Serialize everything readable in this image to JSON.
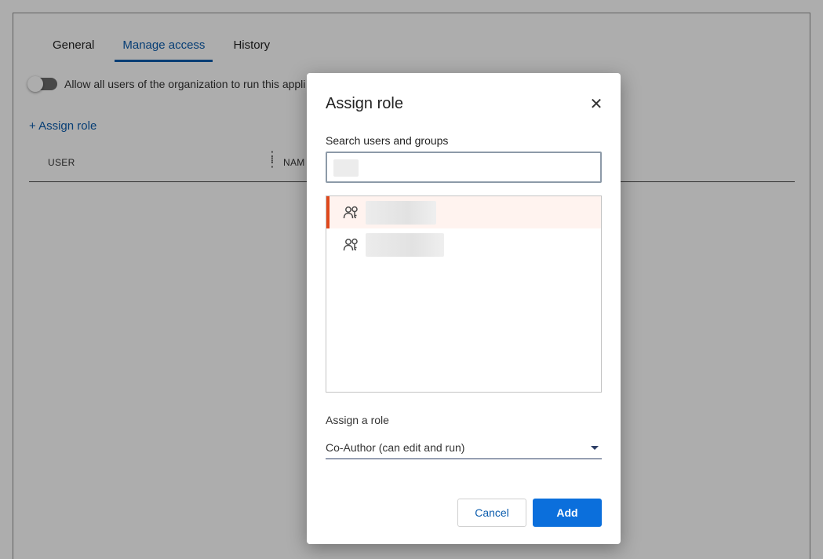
{
  "tabs": [
    {
      "label": "General"
    },
    {
      "label": "Manage access"
    },
    {
      "label": "History"
    }
  ],
  "active_tab": "Manage access",
  "toggle": {
    "label": "Allow all users of the organization to run this appli",
    "state": "off"
  },
  "assign_role_link": "+ Assign role",
  "table": {
    "columns": [
      "USER",
      "NAM"
    ]
  },
  "dialog": {
    "title": "Assign role",
    "close_icon": "close-icon",
    "search_label": "Search users and groups",
    "search_value": "",
    "results": [
      {
        "icon": "group-icon",
        "selected": true
      },
      {
        "icon": "group-icon",
        "selected": false
      }
    ],
    "role_label": "Assign a role",
    "role_value": "Co-Author (can edit and run)",
    "cancel_label": "Cancel",
    "add_label": "Add"
  },
  "colors": {
    "accent": "#0b5cad",
    "primary_button": "#0b6fdc",
    "selected_marker": "#e0481c",
    "selected_bg": "#fff3ef"
  }
}
